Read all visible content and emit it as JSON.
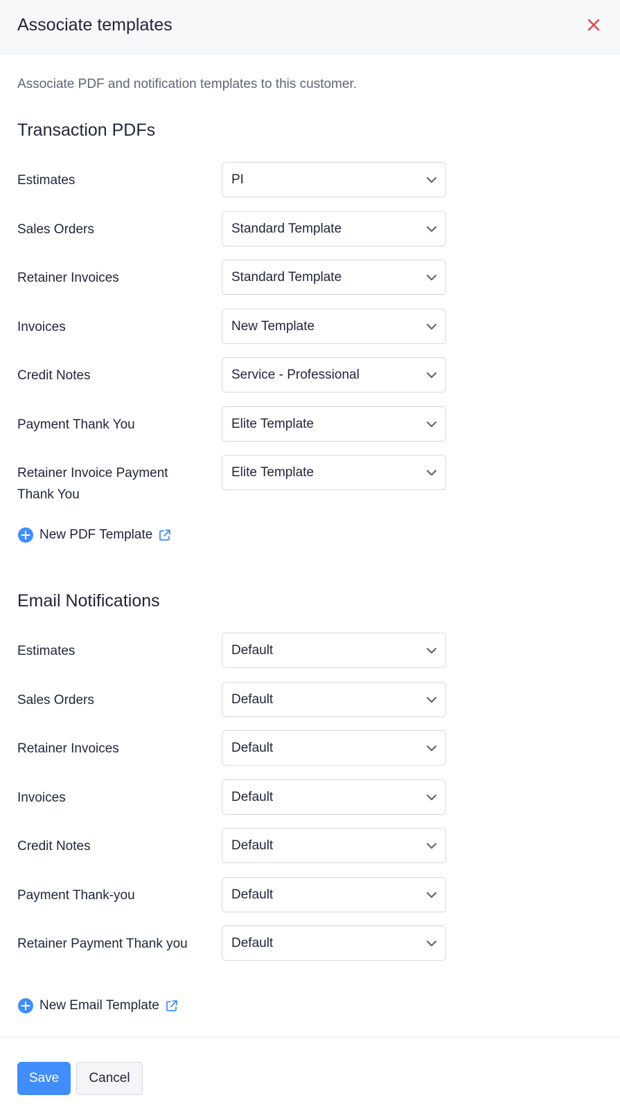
{
  "header": {
    "title": "Associate templates",
    "close_icon": "close-icon"
  },
  "description": "Associate PDF and notification templates to this customer.",
  "pdf_section": {
    "title": "Transaction PDFs",
    "rows": [
      {
        "label": "Estimates",
        "value": "PI"
      },
      {
        "label": "Sales Orders",
        "value": "Standard Template"
      },
      {
        "label": "Retainer Invoices",
        "value": "Standard Template"
      },
      {
        "label": "Invoices",
        "value": "New Template"
      },
      {
        "label": "Credit Notes",
        "value": "Service - Professional"
      },
      {
        "label": "Payment Thank You",
        "value": "Elite Template"
      },
      {
        "label": "Retainer Invoice Payment Thank You",
        "value": "Elite Template"
      }
    ],
    "add_label": "New PDF Template"
  },
  "email_section": {
    "title": "Email Notifications",
    "rows": [
      {
        "label": "Estimates",
        "value": "Default"
      },
      {
        "label": "Sales Orders",
        "value": "Default"
      },
      {
        "label": "Retainer Invoices",
        "value": "Default"
      },
      {
        "label": "Invoices",
        "value": "Default"
      },
      {
        "label": "Credit Notes",
        "value": "Default"
      },
      {
        "label": "Payment Thank-you",
        "value": "Default"
      },
      {
        "label": "Retainer Payment Thank you",
        "value": "Default"
      }
    ],
    "add_label": "New Email Template"
  },
  "footer": {
    "save_label": "Save",
    "cancel_label": "Cancel"
  },
  "colors": {
    "accent": "#408dfb",
    "close": "#e5484d",
    "text": "#21263c",
    "muted": "#5e6579"
  }
}
